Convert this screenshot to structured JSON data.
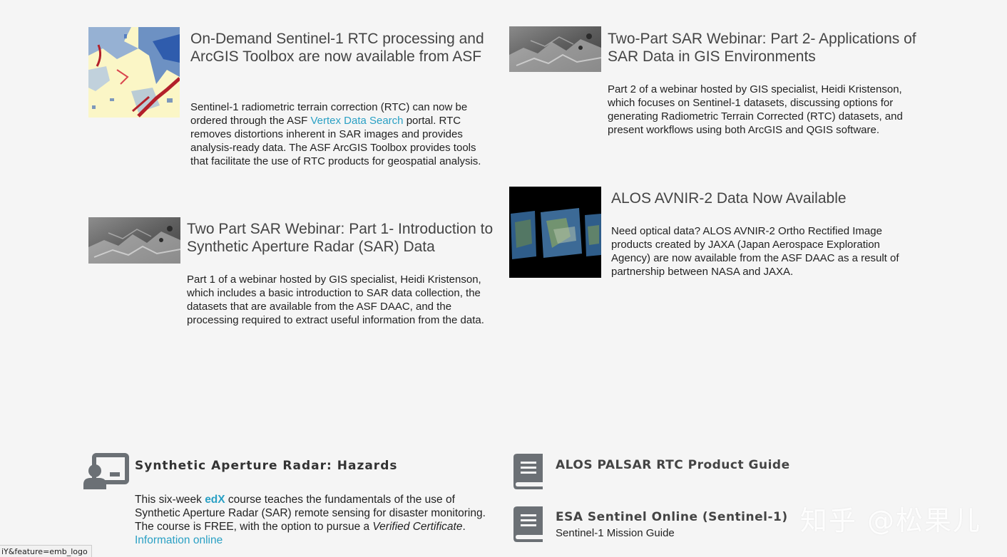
{
  "news": [
    {
      "title": "On-Demand Sentinel-1 RTC processing and ArcGIS Toolbox are now available from ASF",
      "body_before": "Sentinel-1 radiometric terrain correction (RTC) can now be ordered through the ASF ",
      "link": "Vertex Data Search",
      "body_after": " portal. RTC removes distortions inherent in SAR images and provides analysis-ready data. The ASF ArcGIS Toolbox provides tools that facilitate the use of RTC products for geospatial analysis."
    },
    {
      "title": "Two-Part SAR Webinar: Part 2- Applications of SAR Data in GIS Environments",
      "body": "Part 2 of a webinar hosted by GIS specialist, Heidi Kristenson, which focuses on Sentinel-1 datasets, discussing options for generating Radiometric Terrain Corrected (RTC) datasets, and present workflows using both ArcGIS and QGIS software."
    },
    {
      "title": "Two Part SAR Webinar: Part 1- Introduction to Synthetic Aperture Radar (SAR) Data",
      "body": "Part 1 of a webinar hosted by GIS specialist, Heidi Kristenson, which includes a basic introduction to SAR data collection, the datasets that are available from the ASF DAAC, and the processing required to extract useful information from the data."
    },
    {
      "title": "ALOS AVNIR-2 Data Now Available",
      "body": "Need optical data? ALOS AVNIR-2 Ortho Rectified Image products created by JAXA (Japan Aerospace Exploration Agency) are now available from the ASF DAAC as a result of partnership between NASA and JAXA."
    }
  ],
  "course": {
    "title": "Synthetic Aperture Radar: Hazards",
    "p1": "This six-week ",
    "edx": "edX",
    "p2": " course teaches the fundamentals of the use of Synthetic Aperture Radar (SAR) remote sensing for disaster monitoring. The course is FREE, with the option to pursue a ",
    "verified": "Verified Certificate",
    "p3": ". ",
    "info_link": "Information online",
    "icon": "presentation-icon"
  },
  "guides": [
    {
      "title": "ALOS PALSAR RTC Product Guide",
      "subtitle": "",
      "icon": "book-icon"
    },
    {
      "title": "ESA Sentinel Online (Sentinel-1)",
      "subtitle": "Sentinel-1 Mission Guide",
      "icon": "book-icon"
    }
  ],
  "status_bar_url": "iY&feature=emb_logo",
  "watermark": "知乎 @松果儿",
  "colors": {
    "link": "#2aa0c4",
    "icon": "#6b7075",
    "background": "#f5f5f5"
  }
}
